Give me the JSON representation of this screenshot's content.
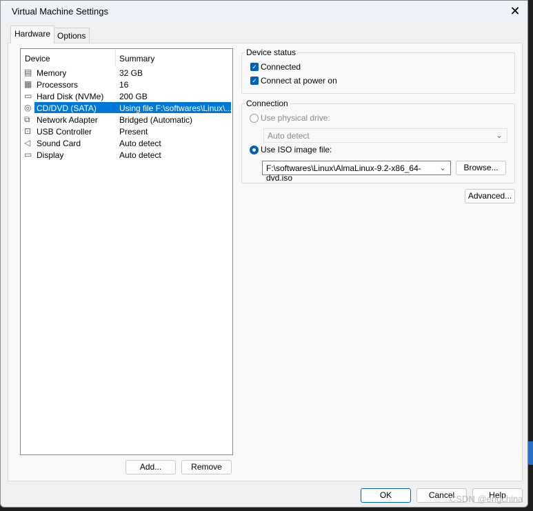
{
  "window": {
    "title": "Virtual Machine Settings",
    "close": "✕"
  },
  "tabs": [
    {
      "label": "Hardware",
      "active": true
    },
    {
      "label": "Options",
      "active": false
    }
  ],
  "device_list": {
    "columns": [
      "Device",
      "Summary"
    ],
    "rows": [
      {
        "icon": "memory-icon",
        "glyph": "▤",
        "name": "Memory",
        "summary": "32 GB"
      },
      {
        "icon": "processor-icon",
        "glyph": "▦",
        "name": "Processors",
        "summary": "16"
      },
      {
        "icon": "hard-disk-icon",
        "glyph": "▭",
        "name": "Hard Disk (NVMe)",
        "summary": "200 GB"
      },
      {
        "icon": "cd-dvd-icon",
        "glyph": "◎",
        "name": "CD/DVD (SATA)",
        "summary": "Using file F:\\softwares\\Linux\\...",
        "selected": true
      },
      {
        "icon": "network-adapter-icon",
        "glyph": "⧉",
        "name": "Network Adapter",
        "summary": "Bridged (Automatic)"
      },
      {
        "icon": "usb-icon",
        "glyph": "⊡",
        "name": "USB Controller",
        "summary": "Present"
      },
      {
        "icon": "sound-icon",
        "glyph": "◁",
        "name": "Sound Card",
        "summary": "Auto detect"
      },
      {
        "icon": "display-icon",
        "glyph": "▭",
        "name": "Display",
        "summary": "Auto detect"
      }
    ]
  },
  "list_buttons": {
    "add": "Add...",
    "remove": "Remove"
  },
  "device_status": {
    "title": "Device status",
    "connected": {
      "label": "Connected",
      "checked": true
    },
    "power_on": {
      "label": "Connect at power on",
      "checked": true
    }
  },
  "connection": {
    "title": "Connection",
    "physical": {
      "label": "Use physical drive:",
      "selected": false,
      "disabled": true,
      "value": "Auto detect"
    },
    "iso": {
      "label": "Use ISO image file:",
      "selected": true,
      "value": "F:\\softwares\\Linux\\AlmaLinux-9.2-x86_64-dvd.iso"
    },
    "browse": "Browse..."
  },
  "advanced": "Advanced...",
  "footer": {
    "ok": "OK",
    "cancel": "Cancel",
    "help": "Help"
  },
  "watermark": "CSDN @engchina",
  "colors": {
    "accent": "#005fb8",
    "selection": "#0078d7"
  }
}
